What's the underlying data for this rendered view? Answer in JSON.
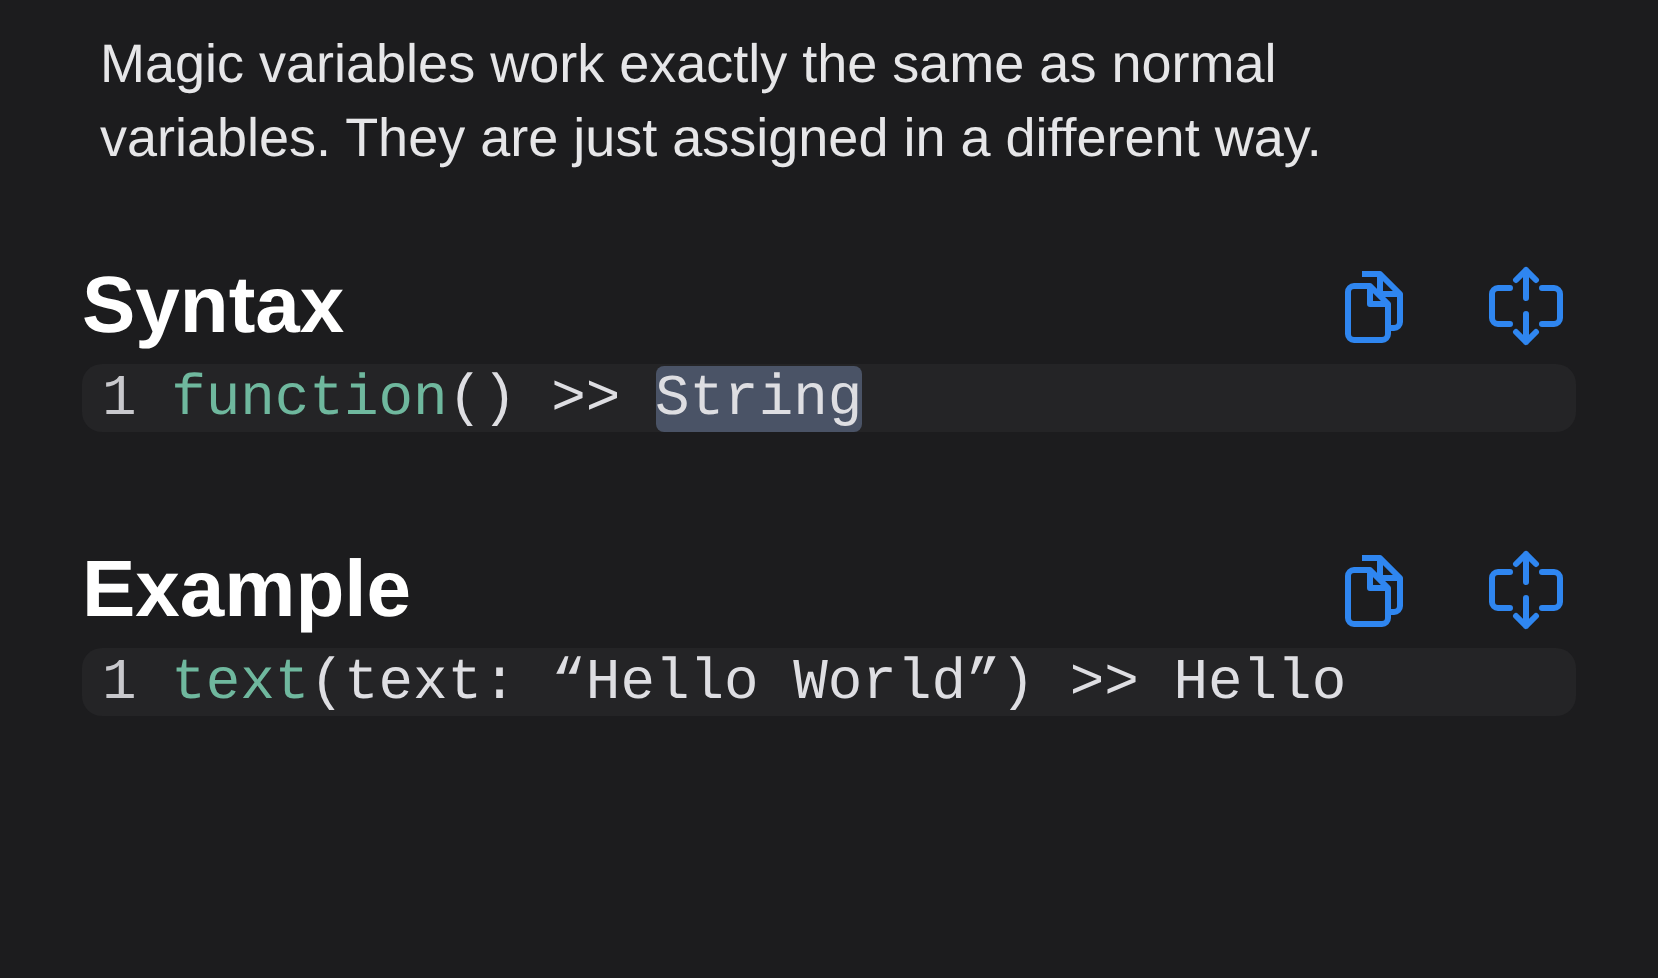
{
  "description": "Magic variables work exactly the same as normal variables. They are just assigned in a different way.",
  "sections": [
    {
      "title": "Syntax",
      "line_number": "1",
      "tokens": [
        {
          "text": "function",
          "kind": "function"
        },
        {
          "text": "() >> ",
          "kind": "plain"
        },
        {
          "text": "String",
          "kind": "selected"
        }
      ]
    },
    {
      "title": "Example",
      "line_number": "1",
      "tokens": [
        {
          "text": "text",
          "kind": "function"
        },
        {
          "text": "(text: “Hello World”) >> Hello",
          "kind": "plain"
        }
      ]
    }
  ]
}
